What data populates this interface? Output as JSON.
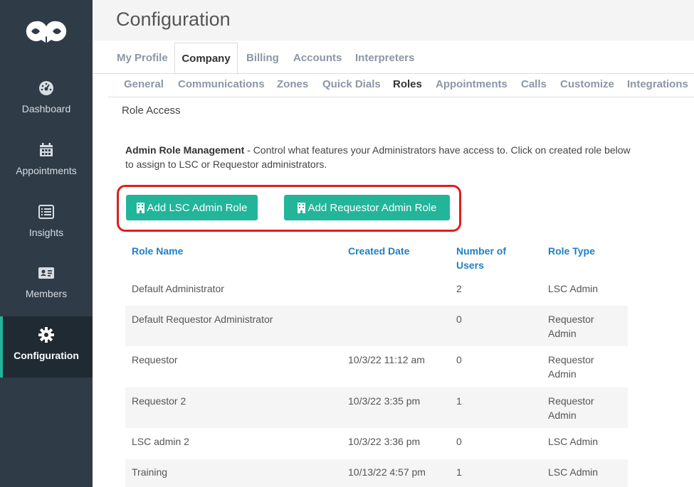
{
  "sidebar": {
    "items": [
      {
        "label": "Dashboard",
        "icon": "dashboard-icon"
      },
      {
        "label": "Appointments",
        "icon": "calendar-icon"
      },
      {
        "label": "Insights",
        "icon": "list-icon"
      },
      {
        "label": "Members",
        "icon": "id-card-icon"
      },
      {
        "label": "Configuration",
        "icon": "gear-icon"
      }
    ],
    "active": "Configuration"
  },
  "header": {
    "title": "Configuration"
  },
  "tabs": [
    {
      "label": "My Profile"
    },
    {
      "label": "Company"
    },
    {
      "label": "Billing"
    },
    {
      "label": "Accounts"
    },
    {
      "label": "Interpreters"
    }
  ],
  "active_tab": "Company",
  "subtabs": [
    {
      "label": "General"
    },
    {
      "label": "Communications"
    },
    {
      "label": "Zones"
    },
    {
      "label": "Quick Dials"
    },
    {
      "label": "Roles"
    },
    {
      "label": "Appointments"
    },
    {
      "label": "Calls"
    },
    {
      "label": "Customize"
    },
    {
      "label": "Integrations"
    }
  ],
  "active_subtab": "Roles",
  "section": {
    "title": "Role Access",
    "desc_bold": "Admin Role Management",
    "desc_text": " - Control what features your Administrators have access to. Click on created role below to assign to LSC or Requestor administrators."
  },
  "buttons": {
    "add_lsc": "Add LSC Admin Role",
    "add_requestor": "Add Requestor Admin Role"
  },
  "table": {
    "headers": [
      "Role Name",
      "Created Date",
      "Number of Users",
      "Role Type"
    ],
    "rows": [
      {
        "name": "Default Administrator",
        "created": "",
        "users": "2",
        "type": "LSC Admin"
      },
      {
        "name": "Default Requestor Administrator",
        "created": "",
        "users": "0",
        "type": "Requestor Admin"
      },
      {
        "name": "Requestor",
        "created": "10/3/22 11:12 am",
        "users": "0",
        "type": "Requestor Admin"
      },
      {
        "name": "Requestor 2",
        "created": "10/3/22 3:35 pm",
        "users": "1",
        "type": "Requestor Admin"
      },
      {
        "name": "LSC admin 2",
        "created": "10/3/22 3:36 pm",
        "users": "0",
        "type": "LSC Admin"
      },
      {
        "name": "Training",
        "created": "10/13/22 4:57 pm",
        "users": "1",
        "type": "LSC Admin"
      }
    ]
  },
  "colors": {
    "sidebar_bg": "#2f3b47",
    "accent": "#22b59a",
    "link_blue": "#1f7fc4",
    "highlight_red": "#e11d1d"
  }
}
